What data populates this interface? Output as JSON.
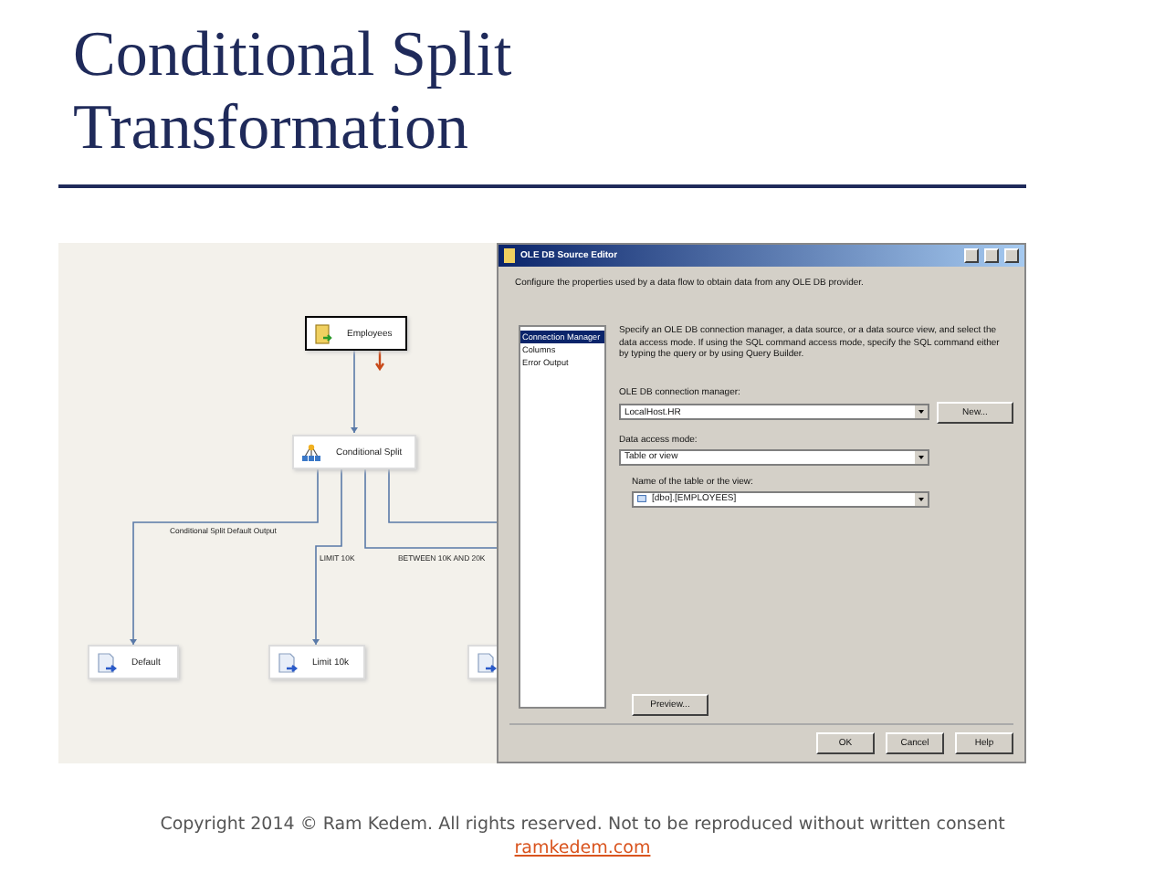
{
  "slide": {
    "title": "Conditional Split Transformation"
  },
  "canvas": {
    "nodes": [
      {
        "label": "Employees",
        "kind": "source",
        "selected": true
      },
      {
        "label": "Conditional Split",
        "kind": "split",
        "selected": false
      },
      {
        "label": "Default",
        "kind": "destination",
        "selected": false
      },
      {
        "label": "Limit 10k",
        "kind": "destination",
        "selected": false
      },
      {
        "kind": "destination",
        "selected": false
      }
    ],
    "paths": [
      "Conditional Split Default Output",
      "LIMIT 10K",
      "BETWEEN 10K AND 20K"
    ]
  },
  "dialog": {
    "title": "OLE DB Source Editor",
    "description": "Configure the properties used by a data flow to obtain data from any OLE DB provider.",
    "pages": [
      {
        "label": "Connection Manager",
        "selected": true
      },
      {
        "label": "Columns",
        "selected": false
      },
      {
        "label": "Error Output",
        "selected": false
      }
    ],
    "instructions": "Specify an OLE DB connection manager, a data source, or a data source view, and select the data access mode. If using the SQL command access mode, specify the SQL command either by typing the query or by using Query Builder.",
    "connection_manager": {
      "label": "OLE DB connection manager:",
      "value": "LocalHost.HR",
      "button": "New..."
    },
    "access_mode": {
      "label": "Data access mode:",
      "value": "Table or view"
    },
    "table": {
      "label": "Name of the table or the view:",
      "value": "[dbo].[EMPLOYEES]"
    },
    "preview_button": "Preview...",
    "buttons": [
      "OK",
      "Cancel",
      "Help"
    ]
  },
  "footer": {
    "copyright": "Copyright 2014 © Ram Kedem. All rights reserved. Not to be reproduced without written consent",
    "link": "ramkedem.com"
  }
}
